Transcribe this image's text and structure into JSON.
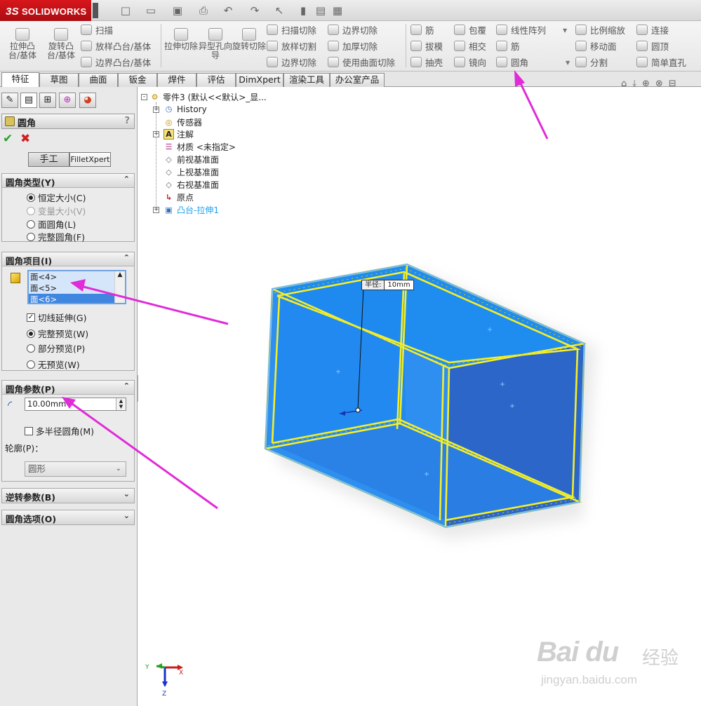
{
  "app": {
    "logo_prefix": "3S",
    "logo_text": "SOLIDWORKS"
  },
  "quick_access": [
    "new-icon",
    "open-icon",
    "save-icon",
    "print-icon",
    "undo-icon",
    "redo-icon",
    "select-icon",
    "rebuild-icon",
    "file-props-icon",
    "options-icon"
  ],
  "command_manager": {
    "extrude_boss": "拉伸凸台/基体",
    "revolve_boss": "旋转凸台/基体",
    "sweep": "扫描",
    "loft_boss": "放样凸台/基体",
    "boundary_boss": "边界凸台/基体",
    "extrude_cut": "拉伸切除",
    "hole_wizard": "异型孔向导",
    "revolve_cut": "旋转切除",
    "swept_cut": "扫描切除",
    "lofted_cut": "放样切割",
    "boundary_cut": "边界切除",
    "boundary_cut2": "边界切除",
    "thicken_cut": "加厚切除",
    "surface_cut": "使用曲面切除",
    "rib": "筋",
    "draft": "拔模",
    "shell": "抽壳",
    "wrap": "包覆",
    "intersect": "相交",
    "mirror": "镜向",
    "linear_pattern": "线性阵列",
    "rib2": "筋",
    "fillet": "圆角",
    "scale": "比例缩放",
    "move_face": "移动面",
    "split": "分割",
    "connect": "连接",
    "dome": "圆顶",
    "simple_hole": "简单直孔"
  },
  "tabs": [
    "特征",
    "草图",
    "曲面",
    "钣金",
    "焊件",
    "评估",
    "DimXpert",
    "渲染工具",
    "办公室产品"
  ],
  "panel": {
    "title": "圆角",
    "help": "?",
    "ok": "✔",
    "cancel": "✖",
    "manual": "手工",
    "filletxpert": "FilletXpert",
    "fillet_type": {
      "header": "圆角类型(Y)",
      "constant": "恒定大小(C)",
      "variable": "变量大小(V)",
      "face_fillet": "面圆角(L)",
      "full_round": "完整圆角(F)"
    },
    "items": {
      "header": "圆角项目(I)",
      "faces": [
        "面<4>",
        "面<5>",
        "面<6>"
      ],
      "tangent": "切线延伸(G)",
      "full_preview": "完整预览(W)",
      "partial_preview": "部分预览(P)",
      "no_preview": "无预览(W)"
    },
    "params": {
      "header": "圆角参数(P)",
      "radius": "10.00mm",
      "multi_radius": "多半径圆角(M)",
      "profile_label": "轮廓(P)：",
      "profile_value": "圆形"
    },
    "setback": {
      "header": "逆转参数(B)"
    },
    "options": {
      "header": "圆角选项(O)"
    }
  },
  "tree": {
    "part": "零件3 (默认<<默认>_显...",
    "history": "History",
    "sensors": "传感器",
    "annotations": "注解",
    "material": "材质 <未指定>",
    "front_plane": "前视基准面",
    "top_plane": "上视基准面",
    "right_plane": "右视基准面",
    "origin": "原点",
    "extrude": "凸台-拉伸1"
  },
  "callout": {
    "label": "半径:",
    "value": "10mm"
  },
  "triad": {
    "x": "X",
    "y": "Y",
    "z": "Z"
  },
  "watermark": {
    "main": "Bai du",
    "cn": "经验",
    "url": "jingyan.baidu.com"
  },
  "colors": {
    "accent": "#e02bd8",
    "model": "#1e7fe0",
    "edge": "#f5f030",
    "logo": "#c8151b"
  }
}
